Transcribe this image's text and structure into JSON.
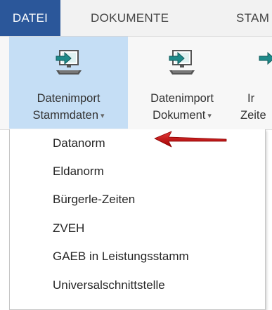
{
  "tabs": [
    {
      "label": "DATEI",
      "active": true
    },
    {
      "label": "DOKUMENTE",
      "active": false
    },
    {
      "label": "STAM",
      "active": false
    }
  ],
  "ribbon": {
    "buttons": [
      {
        "line1": "Datenimport",
        "line2": "Stammdaten",
        "icon": "import-icon",
        "selected": true
      },
      {
        "line1": "Datenimport",
        "line2": "Dokument",
        "icon": "import-icon",
        "selected": false
      },
      {
        "line1": "Ir",
        "line2": "Zeite",
        "icon": "import-icon",
        "selected": false
      }
    ]
  },
  "menu": {
    "items": [
      {
        "label": "Datanorm"
      },
      {
        "label": "Eldanorm"
      },
      {
        "label": "Bürgerle-Zeiten"
      },
      {
        "label": "ZVEH"
      },
      {
        "label": "GAEB in Leistungsstamm"
      },
      {
        "label": "Universalschnittstelle"
      }
    ]
  },
  "colors": {
    "active_tab": "#2b579a",
    "selected_button": "#c5def5",
    "arrow": "#c00000",
    "icon_teal": "#1e8a8a"
  }
}
